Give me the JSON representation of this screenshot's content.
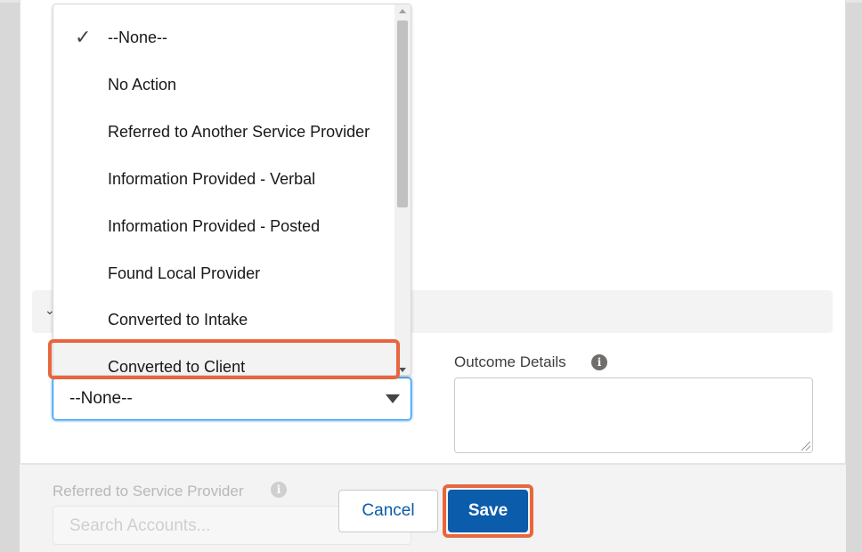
{
  "picklist": {
    "selected_value": "--None--",
    "options": [
      {
        "label": "--None--",
        "checked": true
      },
      {
        "label": "No Action",
        "checked": false
      },
      {
        "label": "Referred to Another Service Provider",
        "checked": false
      },
      {
        "label": "Information Provided - Verbal",
        "checked": false
      },
      {
        "label": "Information Provided - Posted",
        "checked": false
      },
      {
        "label": "Found Local Provider",
        "checked": false
      },
      {
        "label": "Converted to Intake",
        "checked": false
      },
      {
        "label": "Converted to Client",
        "checked": false
      }
    ],
    "hovered_option": "Converted to Client"
  },
  "outcome_details": {
    "label": "Outcome Details",
    "info_glyph": "i",
    "value": ""
  },
  "referred_provider": {
    "label": "Referred to Service Provider",
    "info_glyph": "i",
    "placeholder": "Search Accounts..."
  },
  "footer": {
    "cancel_label": "Cancel",
    "save_label": "Save"
  },
  "colors": {
    "brand_blue": "#0b5cab",
    "focus_blue": "#1b96ff",
    "highlight_orange": "#e8663d"
  }
}
